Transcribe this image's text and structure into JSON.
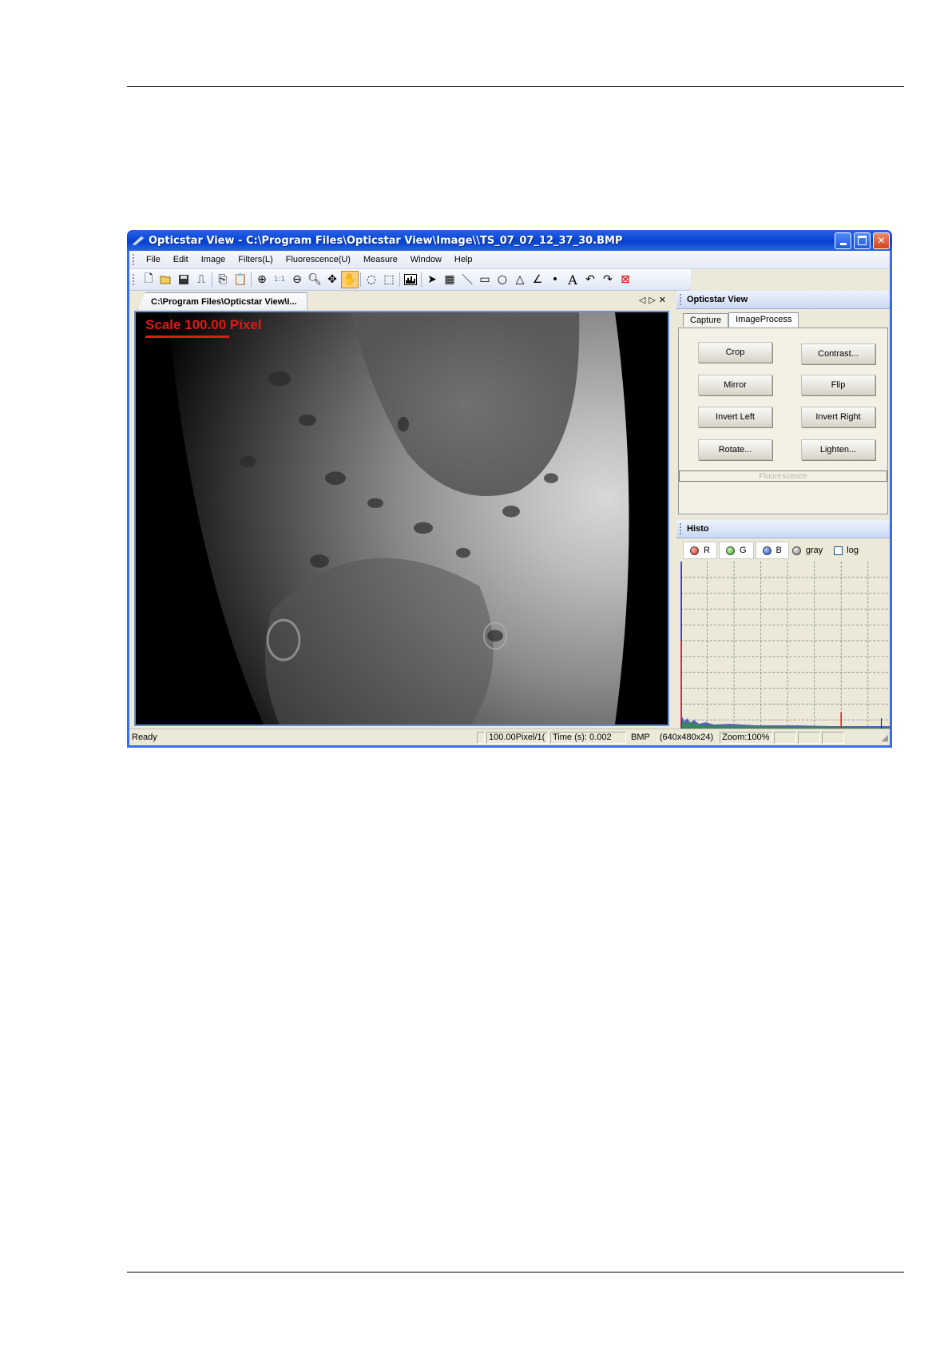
{
  "window": {
    "title": "Opticstar View - C:\\Program Files\\Opticstar View\\Image\\\\TS_07_07_12_37_30.BMP"
  },
  "menu": [
    "File",
    "Edit",
    "Image",
    "Filters(L)",
    "Fluorescence(U)",
    "Measure",
    "Window",
    "Help"
  ],
  "document": {
    "tab_label": "C:\\Program Files\\Opticstar View\\I...",
    "scale_label": "Scale 100.00 Pixel"
  },
  "image_panel": {
    "title": "Opticstar View",
    "tabs": [
      "Capture",
      "ImageProcess"
    ],
    "buttons": {
      "crop": "Crop",
      "contrast": "Contrast...",
      "mirror": "Mirror",
      "flip": "Flip",
      "invert_left": "Invert Left",
      "invert_right": "Invert Right",
      "rotate": "Rotate...",
      "lighten": "Lighten..."
    },
    "fluorescence": "Fluorescence"
  },
  "histo": {
    "title": "Histo",
    "tabs": {
      "r": "R",
      "g": "G",
      "b": "B",
      "gray": "gray"
    },
    "log": "log"
  },
  "status": {
    "ready": "Ready",
    "scale": "100.00Pixel/1(",
    "time": "Time (s): 0.002",
    "format": "BMP",
    "dims": "(640x480x24)",
    "zoom": "Zoom:100%"
  },
  "colors": {
    "title_bar": "#0a48d8",
    "scale_red": "#e01818",
    "histo_r": "#e02020",
    "histo_g": "#20a020",
    "histo_b": "#2020c0"
  }
}
